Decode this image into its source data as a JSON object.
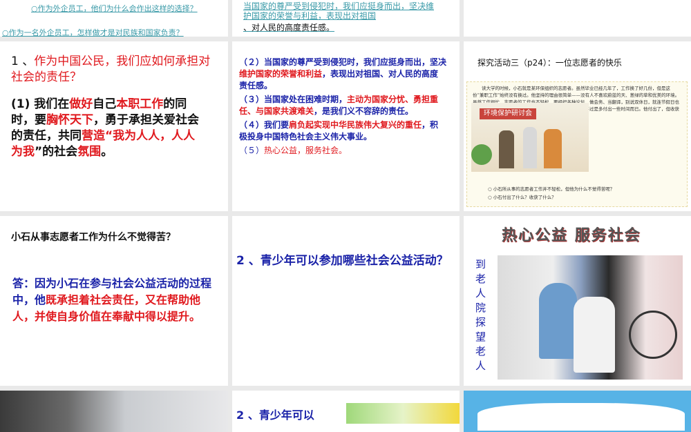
{
  "slides": {
    "s1": {
      "q1": "○作为外企员工，他们为什么会作出这样的选择？",
      "q2": "○作为一名外企员工，怎样做才是对民族和国家负责？"
    },
    "s2": {
      "line1": "当国家的尊严受到侵犯时，我们应挺身而出，坚决维",
      "line2": "护国家的荣誉与利益，表现出对祖国",
      "line3": "、对人民的高度责任感。"
    },
    "s4": {
      "a": "1 、",
      "b": "作为中国公民，我们应如何承担对社会的责任？",
      "c": "(1) 我们在",
      "d": "做好",
      "e": "自己",
      "f": "本职工作",
      "g": "的同时，要",
      "h": "胸怀天下",
      "i": "，勇于承担关爱社会的责任，共同",
      "j": "营造“我为人人，人人为我",
      "k": "”的社会",
      "l": "氛围",
      "m": "。"
    },
    "s5": {
      "p2a": "（２）当国家的尊严受到侵犯时，我们应挺身而出，坚决",
      "p2b": "维护国家的荣誉和利益",
      "p2c": "，表现出对祖国、对人民的高度责任感。",
      "p3a": "（３）当国家处在困难时期，",
      "p3b": "主动为国家分忧、勇担重任、与国家共渡难关",
      "p3c": "，是我们义不容辞的责任。",
      "p4a": "（４）我们要",
      "p4b": "肩负起实现中华民族伟大复兴的重任",
      "p4c": "，积极投身中国特色社会主义伟大事业。",
      "p5a": "（５）",
      "p5b": "热心公益，服务社会。"
    },
    "s6": {
      "title": "探究活动三（p24）：一位志愿者的快乐",
      "para": "读大学的时候，小石就是某环保组织的志愿者。虽然毕业已经几年了，工作换了好几份，但是这份“兼职工作”始终没有换过。他坚持的理由很简单——没有人不喜欢蔚蓝的天、葱绿的草和优美的环境。虽然工作很忙，志愿者的工作也不轻松，要组织各种论坛、做会务、当翻译，别说双休日，就连节假日也没休息过，可是小石并不觉得做志愿者有多苦，而认为只不过是多付出一些时间而已。他付出了，但收获的更多……",
      "banner": "环境保护研讨会",
      "q1": "○ 小石所从事的志愿者工作并不轻松，但他为什么不觉得苦呢？",
      "q2": "○ 小石付出了什么？收获了什么？"
    },
    "s7": {
      "q": "小石从事志愿者工作为什么不觉得苦？",
      "a1": "答：因为小石在参与社会公益活动的过程中，他",
      "a2": "既承担着社会责任，又在帮助他人，并使自身价值在奉献中得以提升。"
    },
    "s8": {
      "q": "2 、青少年可以参加哪些社会公益活动？"
    },
    "s9": {
      "title": "热心公益  服务社会",
      "caption": "到老人院探望老人"
    },
    "s11": {
      "q": "2 、青少年可以"
    }
  }
}
